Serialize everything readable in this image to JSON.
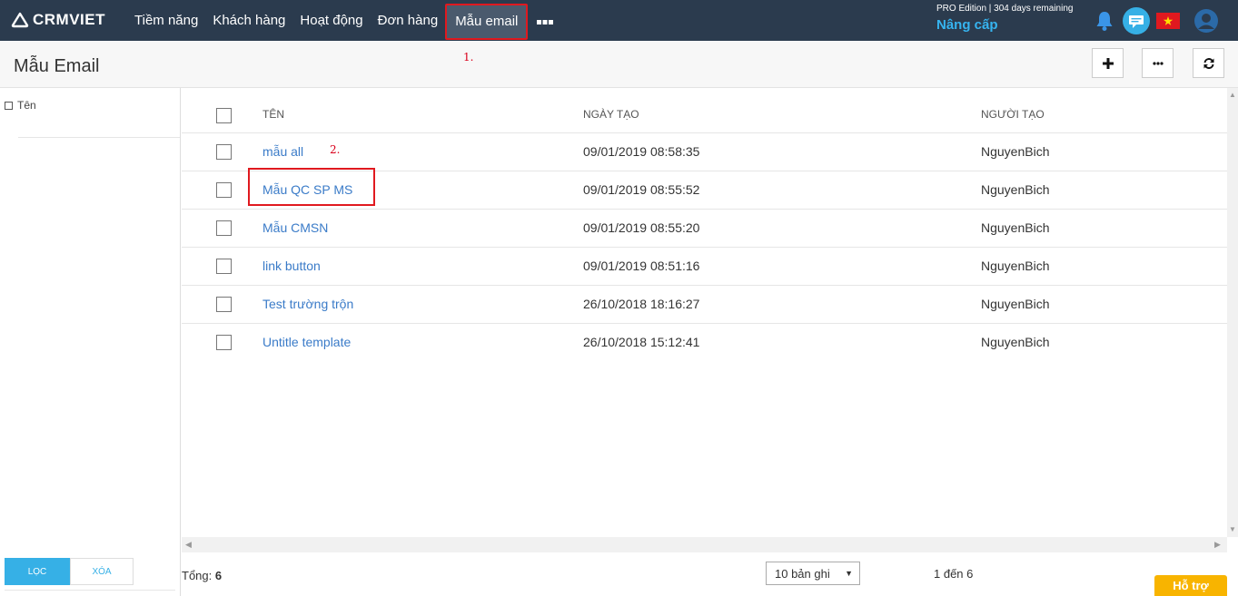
{
  "app": {
    "logo_text": "CRMVIET"
  },
  "nav": {
    "items": [
      {
        "label": "Tiềm năng"
      },
      {
        "label": "Khách hàng"
      },
      {
        "label": "Hoạt động"
      },
      {
        "label": "Đơn hàng"
      },
      {
        "label": "Mẫu email",
        "active": true
      }
    ],
    "more_label": "■■■"
  },
  "account": {
    "edition": "PRO Edition | 304 days remaining",
    "upgrade_label": "Nâng cấp"
  },
  "page": {
    "title": "Mẫu Email"
  },
  "annotations": {
    "step1": "1.",
    "step2": "2."
  },
  "sidebar": {
    "filter_label": "Tên",
    "filter_button": "LỌC",
    "clear_button": "XÓA"
  },
  "table": {
    "headers": {
      "name": "TÊN",
      "created_date": "NGÀY TẠO",
      "created_by": "NGƯỜI TẠO"
    },
    "rows": [
      {
        "name": "mẫu all",
        "created_date": "09/01/2019 08:58:35",
        "created_by": "NguyenBich"
      },
      {
        "name": "Mẫu QC SP MS",
        "created_date": "09/01/2019 08:55:52",
        "created_by": "NguyenBich"
      },
      {
        "name": "Mẫu CMSN",
        "created_date": "09/01/2019 08:55:20",
        "created_by": "NguyenBich"
      },
      {
        "name": "link button",
        "created_date": "09/01/2019 08:51:16",
        "created_by": "NguyenBich"
      },
      {
        "name": "Test trường trộn",
        "created_date": "26/10/2018 18:16:27",
        "created_by": "NguyenBich"
      },
      {
        "name": "Untitle template",
        "created_date": "26/10/2018 15:12:41",
        "created_by": "NguyenBich"
      }
    ]
  },
  "footer": {
    "total_label": "Tổng:",
    "total_value": "6",
    "page_size": "10 bản ghi",
    "range": "1 đến 6",
    "support_label": "Hỗ trợ"
  },
  "colors": {
    "topbar": "#2b3b4e",
    "accent_blue": "#36b0e6",
    "link_blue": "#3a7bc8",
    "highlight_red": "#e0191f",
    "support_yellow": "#f8b400"
  },
  "icons": [
    "logo-icon",
    "bell-icon",
    "chat-icon",
    "vietnam-flag-icon",
    "user-avatar-icon",
    "plus-icon",
    "more-icon",
    "refresh-icon"
  ]
}
